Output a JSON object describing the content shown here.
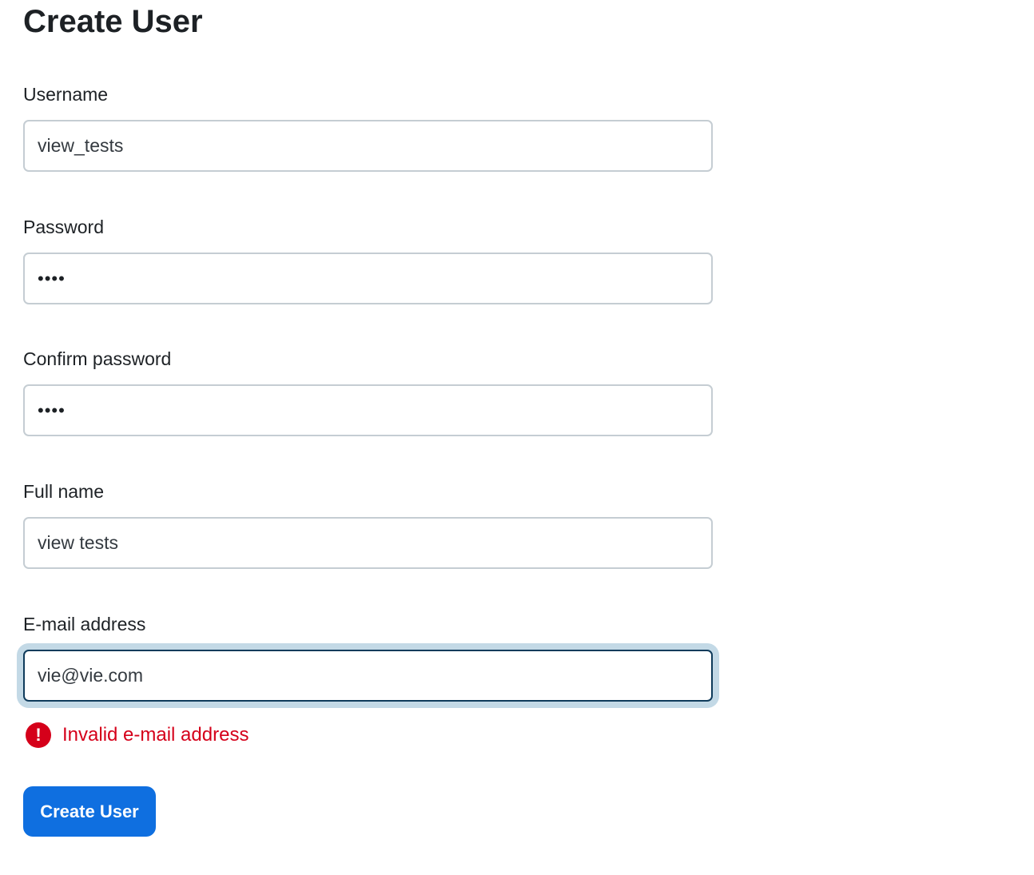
{
  "page": {
    "title": "Create User"
  },
  "form": {
    "username": {
      "label": "Username",
      "value": "view_tests"
    },
    "password": {
      "label": "Password",
      "value": "••••"
    },
    "confirm_password": {
      "label": "Confirm password",
      "value": "••••"
    },
    "full_name": {
      "label": "Full name",
      "value": "view tests"
    },
    "email": {
      "label": "E-mail address",
      "value": "vie@vie.com",
      "error": "Invalid e-mail address",
      "error_icon": "exclamation-icon"
    },
    "submit_label": "Create User"
  },
  "colors": {
    "primary": "#0f6fe0",
    "error": "#d5001a",
    "focus_border": "#0f3b5b",
    "focus_ring": "#c3d9e6",
    "input_border": "#c5cdd3"
  }
}
